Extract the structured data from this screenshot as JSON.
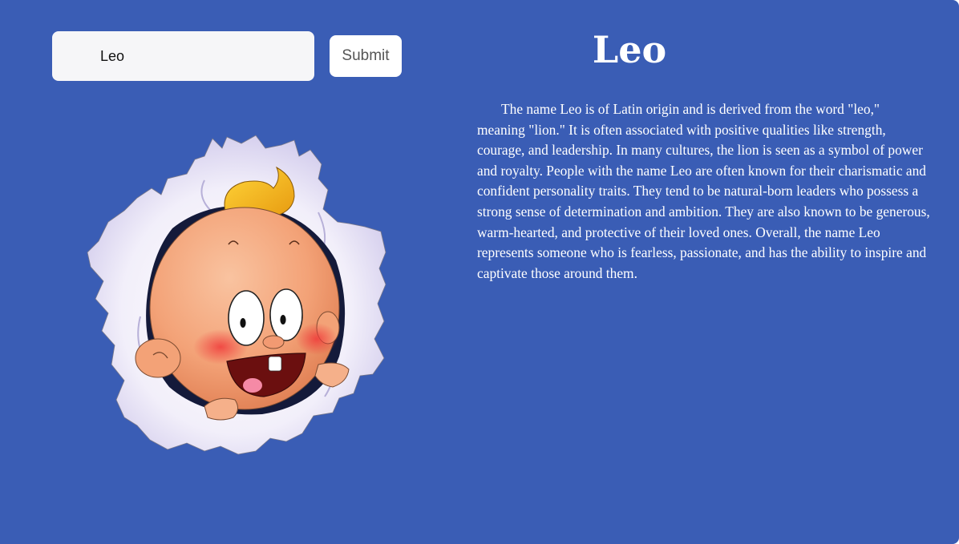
{
  "search": {
    "value": "Leo"
  },
  "submit": {
    "label": "Submit"
  },
  "result": {
    "name": "Leo",
    "description": "The name Leo is of Latin origin and is derived from the word \"leo,\" meaning \"lion.\" It is often associated with positive qualities like strength, courage, and leadership. In many cultures, the lion is seen as a symbol of power and royalty. People with the name Leo are often known for their charismatic and confident personality traits. They tend to be natural-born leaders who possess a strong sense of determination and ambition. They are also known to be generous, warm-hearted, and protective of their loved ones. Overall, the name Leo represents someone who is fearless, passionate, and has the ability to inspire and captivate those around them."
  },
  "illustration": {
    "icon": "baby-breaking-through-paper-icon"
  },
  "colors": {
    "background": "#3a5db5",
    "input_bg": "#f6f6f8",
    "button_bg": "#ffffff",
    "text": "#ffffff"
  }
}
